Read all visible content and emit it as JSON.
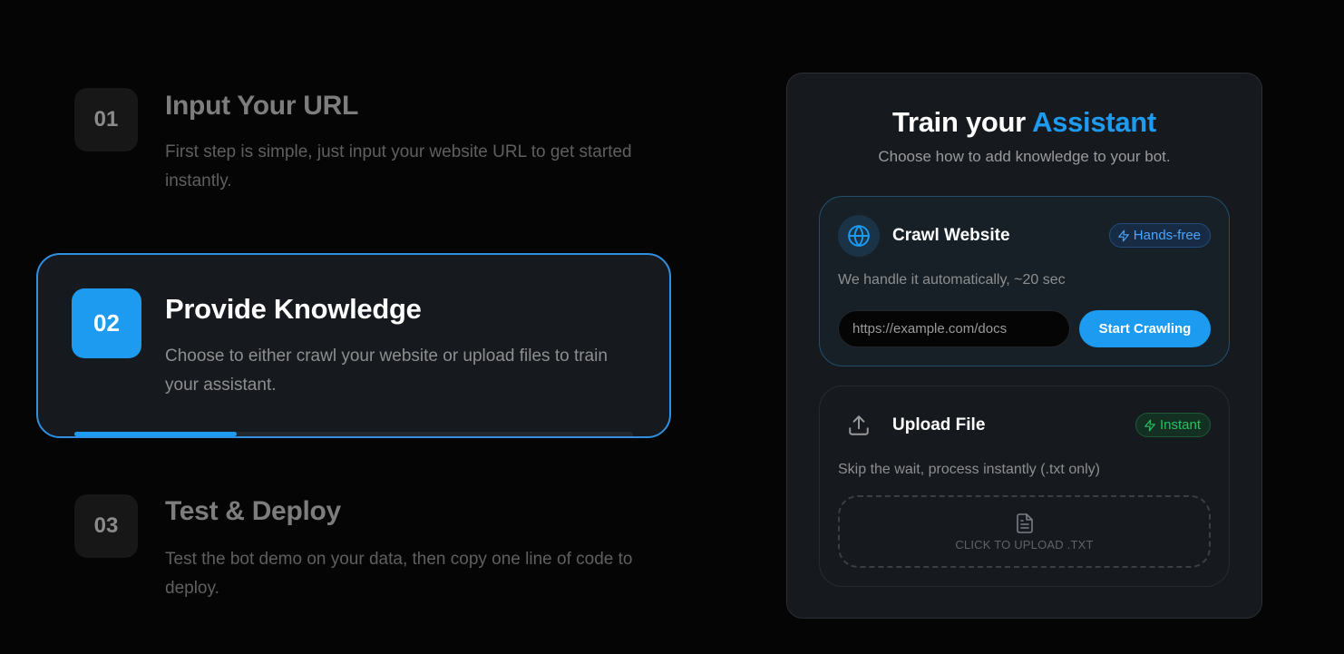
{
  "steps": [
    {
      "number": "01",
      "title": "Input Your URL",
      "description": "First step is simple, just input your website URL to get started instantly."
    },
    {
      "number": "02",
      "title": "Provide Knowledge",
      "description": "Choose to either crawl your website or upload files to train your assistant.",
      "progress_fraction": 0.29
    },
    {
      "number": "03",
      "title": "Test & Deploy",
      "description": "Test the bot demo on your data, then copy one line of code to deploy."
    }
  ],
  "card": {
    "title_prefix": "Train your ",
    "title_accent": "Assistant",
    "subtitle": "Choose how to add knowledge to your bot.",
    "crawl": {
      "title": "Crawl Website",
      "badge": "Hands-free",
      "description": "We handle it automatically, ~20 sec",
      "input_placeholder": "https://example.com/docs",
      "button_label": "Start Crawling",
      "icon": "globe-icon"
    },
    "upload": {
      "title": "Upload File",
      "badge": "Instant",
      "description": "Skip the wait, process instantly (.txt only)",
      "dropzone_label": "CLICK TO UPLOAD .TXT",
      "icon": "upload-icon"
    }
  },
  "colors": {
    "accent": "#1d9bf0",
    "success": "#22c55e",
    "background": "#050505",
    "card": "#16191e"
  }
}
